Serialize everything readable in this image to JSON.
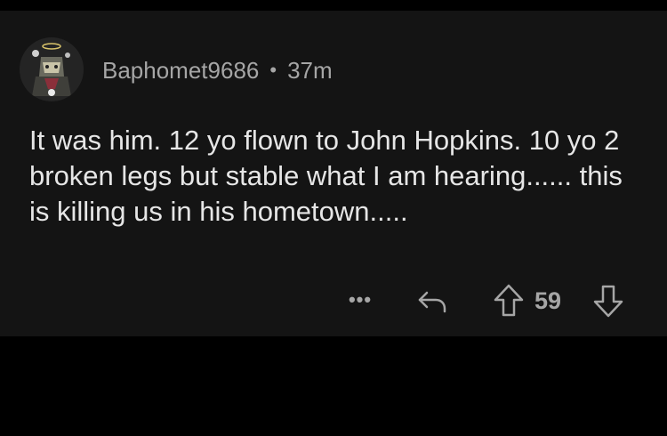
{
  "comment": {
    "author": "Baphomet9686",
    "separator": "•",
    "time": "37m",
    "text": "It was him. 12 yo flown to John Hopkins. 10 yo 2 broken legs but stable what I am hearing...... this is killing us in his hometown.....",
    "more_label": "•••",
    "vote_count": "59"
  },
  "icons": {
    "avatar": "snoo-avatar",
    "reply": "reply-arrow-icon",
    "upvote": "upvote-arrow-icon",
    "downvote": "downvote-arrow-icon"
  },
  "colors": {
    "page_background": "#000000",
    "card_background": "#141414",
    "primary_text": "#e6e6e6",
    "secondary_text": "#a6a6a6"
  }
}
